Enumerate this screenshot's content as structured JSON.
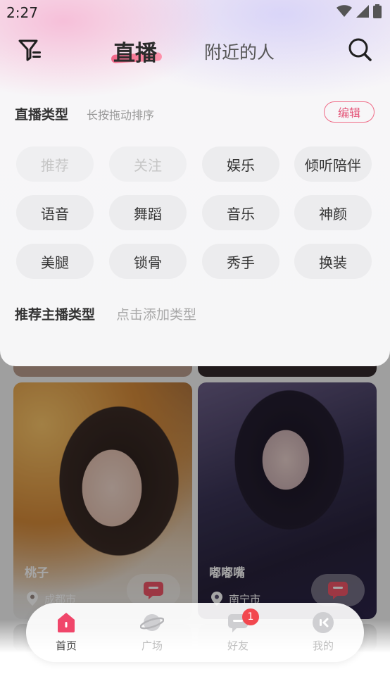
{
  "status_bar": {
    "time": "2:27"
  },
  "header": {
    "tabs": [
      {
        "label": "直播"
      },
      {
        "label": "附近的人"
      }
    ]
  },
  "live_types": {
    "title": "直播类型",
    "hint": "长按拖动排序",
    "edit_label": "编辑",
    "tags": [
      "推荐",
      "关注",
      "娱乐",
      "倾听陪伴",
      "语音",
      "舞蹈",
      "音乐",
      "神颜",
      "美腿",
      "锁骨",
      "秀手",
      "换装"
    ],
    "disabled_tags": [
      "推荐",
      "关注"
    ]
  },
  "recommend": {
    "title": "推荐主播类型",
    "hint": "点击添加类型"
  },
  "cards": [
    {
      "name": "桃子",
      "city": "成都市"
    },
    {
      "name": "嘟嘟嘴",
      "city": "南宁市"
    }
  ],
  "nav": {
    "items": [
      {
        "label": "首页",
        "icon": "home-icon"
      },
      {
        "label": "广场",
        "icon": "planet-icon"
      },
      {
        "label": "好友",
        "icon": "message-icon",
        "badge": "1"
      },
      {
        "label": "我的",
        "icon": "profile-icon"
      }
    ]
  },
  "colors": {
    "accent": "#e4577a",
    "badge": "#f2484f"
  }
}
